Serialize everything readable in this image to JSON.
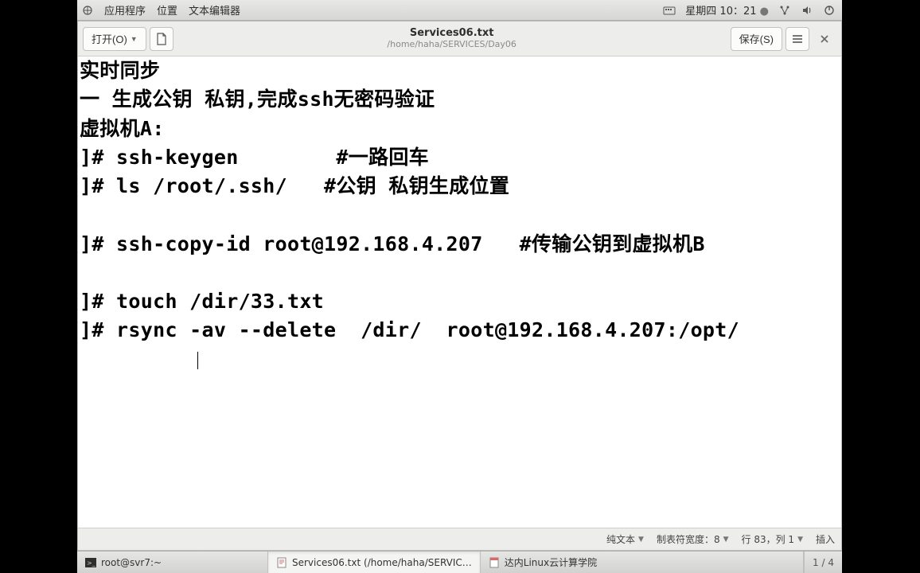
{
  "topbar": {
    "apps_label": "应用程序",
    "places_label": "位置",
    "app_name": "文本编辑器",
    "clock": "星期四 10：21",
    "clock_dot": "●"
  },
  "toolbar": {
    "open_label": "打开(O)",
    "save_label": "保存(S)"
  },
  "title": {
    "filename": "Services06.txt",
    "path": "/home/haha/SERVICES/Day06"
  },
  "editor": {
    "line1": "实时同步",
    "line2": "一 生成公钥 私钥,完成ssh无密码验证",
    "line3": "虚拟机A:",
    "line4": "]# ssh-keygen        #一路回车",
    "line5": "]# ls /root/.ssh/   #公钥 私钥生成位置",
    "line6": "",
    "line7": "]# ssh-copy-id root@192.168.4.207   #传输公钥到虚拟机B",
    "line8": "",
    "line9": "]# touch /dir/33.txt",
    "line10": "]# rsync -av --delete  /dir/  root@192.168.4.207:/opt/"
  },
  "statusbar": {
    "syntax": "纯文本",
    "tabwidth": "制表符宽度：8",
    "rowcol": "行 83，列 1",
    "mode": "插入"
  },
  "taskbar": {
    "t1": "root@svr7:~",
    "t2": "Services06.txt (/home/haha/SERVIC…",
    "t3": "达内Linux云计算学院"
  },
  "status_footer": {
    "pages": "1 / 4"
  }
}
